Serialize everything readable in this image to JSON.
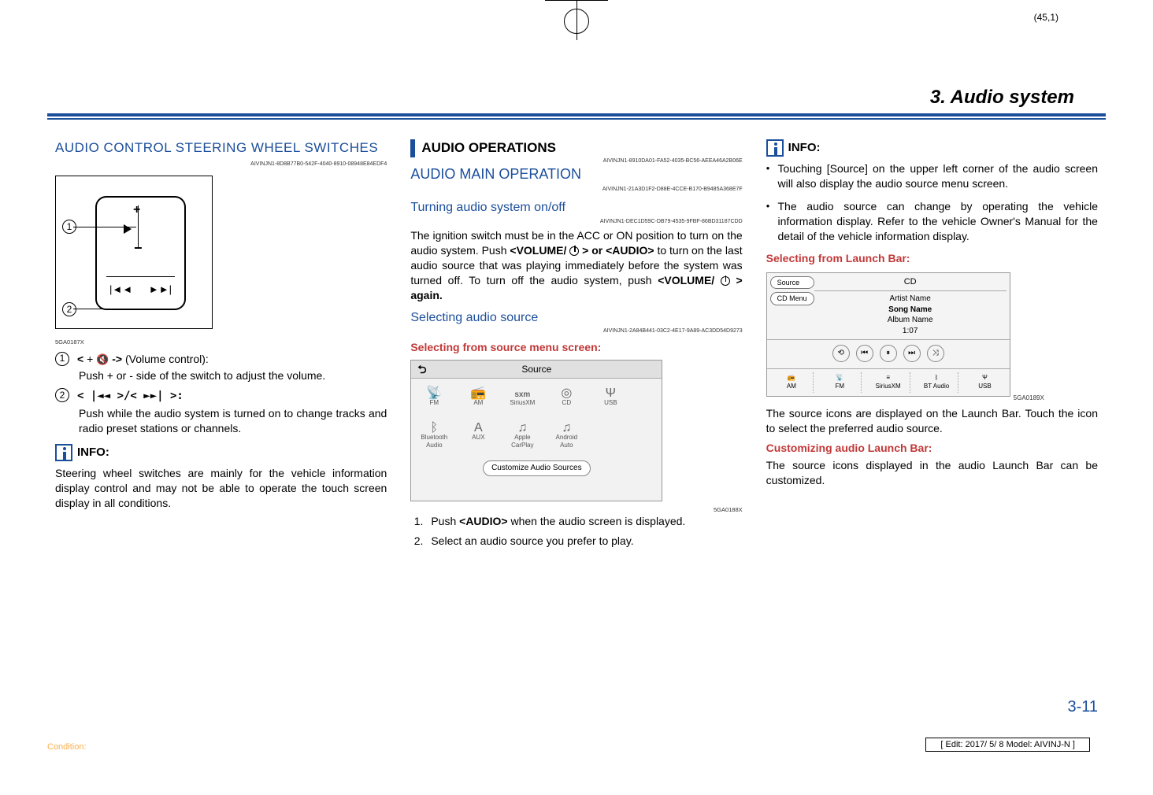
{
  "coord_ref": "(45,1)",
  "page_header": "3. Audio system",
  "col1": {
    "heading": "AUDIO CONTROL STEERING WHEEL SWITCHES",
    "heading_code": "AIVINJN1-8D8B77B0-542F-4040-8910-08948E84EDF4",
    "diagram_id": "5GA0187X",
    "item1": {
      "num": "1",
      "label_prefix": "<",
      "label_mid": " + ",
      "label_suffix": " -> ",
      "label_desc": "(Volume control):",
      "body": "Push + or - side of the switch to adjust the volume."
    },
    "item2": {
      "num": "2",
      "label": "< |◄◄ >/< ►►| >:",
      "body": "Push while the audio system is turned on to change tracks and radio preset stations or channels."
    },
    "info_label": "INFO:",
    "info_body": "Steering wheel switches are mainly for the vehicle information display control and may not be able to operate the touch screen display in all conditions."
  },
  "col2": {
    "ops_heading": "AUDIO OPERATIONS",
    "ops_code": "AIVINJN1-8910DA01-FA52-4035-BC56-AEEA46A2B06E",
    "main_heading": "AUDIO MAIN OPERATION",
    "main_code": "AIVINJN1-21A3D1F2-D88E-4CCE-B170-B9485A368E7F",
    "turn_heading": "Turning audio system on/off",
    "turn_code": "AIVINJN1-DEC1D59C-DB79-4535-9FBF-86BD31187CDD",
    "turn_body1": "The ignition switch must be in the ACC or ON position to turn on the audio system. Push ",
    "turn_vol": "<VOLUME/",
    "turn_or": " > or ",
    "turn_audio": "<AUDIO>",
    "turn_body2": " to turn on the last audio source that was playing immediately before the system was turned off. To turn off the audio system, push ",
    "turn_again": " > again.",
    "sel_heading": "Selecting audio source",
    "sel_code": "AIVINJN1-2A84B441-03C2-4E17-9A89-AC3DD54D9273",
    "sel_sub": "Selecting from source menu screen:",
    "screen_label": "5GA0188X",
    "source_title": "Source",
    "sources": {
      "fm": "FM",
      "am": "AM",
      "sxm": "SiriusXM",
      "cd": "CD",
      "usb": "USB",
      "bt": "Bluetooth Audio",
      "aux": "AUX",
      "apple": "Apple CarPlay",
      "android": "Android Auto"
    },
    "customize_btn": "Customize Audio Sources",
    "step1_a": "Push ",
    "step1_b": "<AUDIO>",
    "step1_c": " when the audio screen is displayed.",
    "step2": "Select an audio source you prefer to play."
  },
  "col3": {
    "info_label": "INFO:",
    "bullet1": "Touching [Source] on the upper left corner of the audio screen will also display the audio source menu screen.",
    "bullet2": "The audio source can change by operating the vehicle information display. Refer to the vehicle Owner's Manual for the detail of the vehicle information display.",
    "launch_sub": "Selecting from Launch Bar:",
    "screen_label": "5GA0189X",
    "cd_title": "CD",
    "cd_source_btn": "Source",
    "cd_menu_btn": "CD Menu",
    "cd_artist": "Artist Name",
    "cd_song": "Song Name",
    "cd_album": "Album Name",
    "cd_time": "1:07",
    "launch_items": {
      "am": "AM",
      "fm": "FM",
      "sxm": "SiriusXM",
      "bt": "BT Audio",
      "usb": "USB"
    },
    "launch_body": "The source icons are displayed on the Launch Bar. Touch the icon to select the preferred audio source.",
    "customize_sub": "Customizing audio Launch Bar:",
    "customize_body": "The source icons displayed in the audio Launch Bar can be customized."
  },
  "page_num": "3-11",
  "footer_left": "Condition:",
  "footer_right": "[ Edit: 2017/ 5/ 8    Model:  AIVINJ-N ]"
}
